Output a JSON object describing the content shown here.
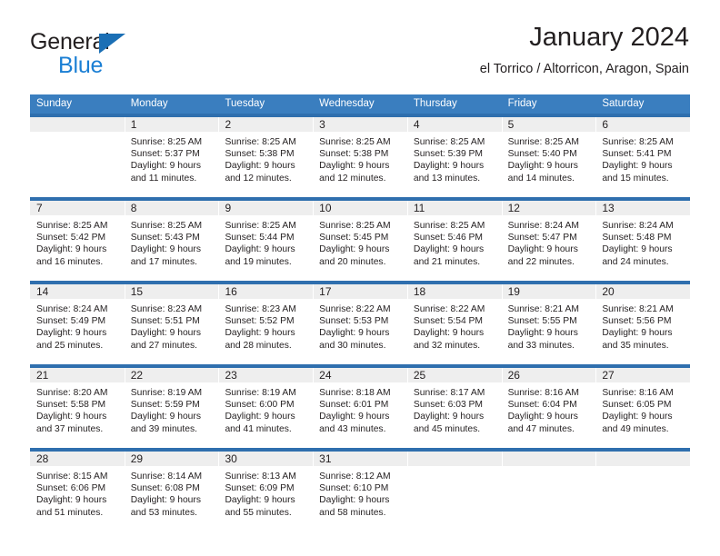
{
  "brand": {
    "name_part1": "General",
    "name_part2": "Blue",
    "triangle_color": "#1b6fb5",
    "blue_text_color": "#1b7fd4"
  },
  "header": {
    "title": "January 2024",
    "subtitle": "el Torrico / Altorricon, Aragon, Spain"
  },
  "theme": {
    "header_row_bg": "#3a7ebf",
    "week_divider": "#2f6fae",
    "daynum_band_bg": "#eeeeee",
    "text_color": "#231f20"
  },
  "weekdays": [
    "Sunday",
    "Monday",
    "Tuesday",
    "Wednesday",
    "Thursday",
    "Friday",
    "Saturday"
  ],
  "weeks": [
    [
      {
        "day": "",
        "sunrise": "",
        "sunset": "",
        "daylight_line1": "",
        "daylight_line2": ""
      },
      {
        "day": "1",
        "sunrise": "Sunrise: 8:25 AM",
        "sunset": "Sunset: 5:37 PM",
        "daylight_line1": "Daylight: 9 hours",
        "daylight_line2": "and 11 minutes."
      },
      {
        "day": "2",
        "sunrise": "Sunrise: 8:25 AM",
        "sunset": "Sunset: 5:38 PM",
        "daylight_line1": "Daylight: 9 hours",
        "daylight_line2": "and 12 minutes."
      },
      {
        "day": "3",
        "sunrise": "Sunrise: 8:25 AM",
        "sunset": "Sunset: 5:38 PM",
        "daylight_line1": "Daylight: 9 hours",
        "daylight_line2": "and 12 minutes."
      },
      {
        "day": "4",
        "sunrise": "Sunrise: 8:25 AM",
        "sunset": "Sunset: 5:39 PM",
        "daylight_line1": "Daylight: 9 hours",
        "daylight_line2": "and 13 minutes."
      },
      {
        "day": "5",
        "sunrise": "Sunrise: 8:25 AM",
        "sunset": "Sunset: 5:40 PM",
        "daylight_line1": "Daylight: 9 hours",
        "daylight_line2": "and 14 minutes."
      },
      {
        "day": "6",
        "sunrise": "Sunrise: 8:25 AM",
        "sunset": "Sunset: 5:41 PM",
        "daylight_line1": "Daylight: 9 hours",
        "daylight_line2": "and 15 minutes."
      }
    ],
    [
      {
        "day": "7",
        "sunrise": "Sunrise: 8:25 AM",
        "sunset": "Sunset: 5:42 PM",
        "daylight_line1": "Daylight: 9 hours",
        "daylight_line2": "and 16 minutes."
      },
      {
        "day": "8",
        "sunrise": "Sunrise: 8:25 AM",
        "sunset": "Sunset: 5:43 PM",
        "daylight_line1": "Daylight: 9 hours",
        "daylight_line2": "and 17 minutes."
      },
      {
        "day": "9",
        "sunrise": "Sunrise: 8:25 AM",
        "sunset": "Sunset: 5:44 PM",
        "daylight_line1": "Daylight: 9 hours",
        "daylight_line2": "and 19 minutes."
      },
      {
        "day": "10",
        "sunrise": "Sunrise: 8:25 AM",
        "sunset": "Sunset: 5:45 PM",
        "daylight_line1": "Daylight: 9 hours",
        "daylight_line2": "and 20 minutes."
      },
      {
        "day": "11",
        "sunrise": "Sunrise: 8:25 AM",
        "sunset": "Sunset: 5:46 PM",
        "daylight_line1": "Daylight: 9 hours",
        "daylight_line2": "and 21 minutes."
      },
      {
        "day": "12",
        "sunrise": "Sunrise: 8:24 AM",
        "sunset": "Sunset: 5:47 PM",
        "daylight_line1": "Daylight: 9 hours",
        "daylight_line2": "and 22 minutes."
      },
      {
        "day": "13",
        "sunrise": "Sunrise: 8:24 AM",
        "sunset": "Sunset: 5:48 PM",
        "daylight_line1": "Daylight: 9 hours",
        "daylight_line2": "and 24 minutes."
      }
    ],
    [
      {
        "day": "14",
        "sunrise": "Sunrise: 8:24 AM",
        "sunset": "Sunset: 5:49 PM",
        "daylight_line1": "Daylight: 9 hours",
        "daylight_line2": "and 25 minutes."
      },
      {
        "day": "15",
        "sunrise": "Sunrise: 8:23 AM",
        "sunset": "Sunset: 5:51 PM",
        "daylight_line1": "Daylight: 9 hours",
        "daylight_line2": "and 27 minutes."
      },
      {
        "day": "16",
        "sunrise": "Sunrise: 8:23 AM",
        "sunset": "Sunset: 5:52 PM",
        "daylight_line1": "Daylight: 9 hours",
        "daylight_line2": "and 28 minutes."
      },
      {
        "day": "17",
        "sunrise": "Sunrise: 8:22 AM",
        "sunset": "Sunset: 5:53 PM",
        "daylight_line1": "Daylight: 9 hours",
        "daylight_line2": "and 30 minutes."
      },
      {
        "day": "18",
        "sunrise": "Sunrise: 8:22 AM",
        "sunset": "Sunset: 5:54 PM",
        "daylight_line1": "Daylight: 9 hours",
        "daylight_line2": "and 32 minutes."
      },
      {
        "day": "19",
        "sunrise": "Sunrise: 8:21 AM",
        "sunset": "Sunset: 5:55 PM",
        "daylight_line1": "Daylight: 9 hours",
        "daylight_line2": "and 33 minutes."
      },
      {
        "day": "20",
        "sunrise": "Sunrise: 8:21 AM",
        "sunset": "Sunset: 5:56 PM",
        "daylight_line1": "Daylight: 9 hours",
        "daylight_line2": "and 35 minutes."
      }
    ],
    [
      {
        "day": "21",
        "sunrise": "Sunrise: 8:20 AM",
        "sunset": "Sunset: 5:58 PM",
        "daylight_line1": "Daylight: 9 hours",
        "daylight_line2": "and 37 minutes."
      },
      {
        "day": "22",
        "sunrise": "Sunrise: 8:19 AM",
        "sunset": "Sunset: 5:59 PM",
        "daylight_line1": "Daylight: 9 hours",
        "daylight_line2": "and 39 minutes."
      },
      {
        "day": "23",
        "sunrise": "Sunrise: 8:19 AM",
        "sunset": "Sunset: 6:00 PM",
        "daylight_line1": "Daylight: 9 hours",
        "daylight_line2": "and 41 minutes."
      },
      {
        "day": "24",
        "sunrise": "Sunrise: 8:18 AM",
        "sunset": "Sunset: 6:01 PM",
        "daylight_line1": "Daylight: 9 hours",
        "daylight_line2": "and 43 minutes."
      },
      {
        "day": "25",
        "sunrise": "Sunrise: 8:17 AM",
        "sunset": "Sunset: 6:03 PM",
        "daylight_line1": "Daylight: 9 hours",
        "daylight_line2": "and 45 minutes."
      },
      {
        "day": "26",
        "sunrise": "Sunrise: 8:16 AM",
        "sunset": "Sunset: 6:04 PM",
        "daylight_line1": "Daylight: 9 hours",
        "daylight_line2": "and 47 minutes."
      },
      {
        "day": "27",
        "sunrise": "Sunrise: 8:16 AM",
        "sunset": "Sunset: 6:05 PM",
        "daylight_line1": "Daylight: 9 hours",
        "daylight_line2": "and 49 minutes."
      }
    ],
    [
      {
        "day": "28",
        "sunrise": "Sunrise: 8:15 AM",
        "sunset": "Sunset: 6:06 PM",
        "daylight_line1": "Daylight: 9 hours",
        "daylight_line2": "and 51 minutes."
      },
      {
        "day": "29",
        "sunrise": "Sunrise: 8:14 AM",
        "sunset": "Sunset: 6:08 PM",
        "daylight_line1": "Daylight: 9 hours",
        "daylight_line2": "and 53 minutes."
      },
      {
        "day": "30",
        "sunrise": "Sunrise: 8:13 AM",
        "sunset": "Sunset: 6:09 PM",
        "daylight_line1": "Daylight: 9 hours",
        "daylight_line2": "and 55 minutes."
      },
      {
        "day": "31",
        "sunrise": "Sunrise: 8:12 AM",
        "sunset": "Sunset: 6:10 PM",
        "daylight_line1": "Daylight: 9 hours",
        "daylight_line2": "and 58 minutes."
      },
      {
        "day": "",
        "sunrise": "",
        "sunset": "",
        "daylight_line1": "",
        "daylight_line2": ""
      },
      {
        "day": "",
        "sunrise": "",
        "sunset": "",
        "daylight_line1": "",
        "daylight_line2": ""
      },
      {
        "day": "",
        "sunrise": "",
        "sunset": "",
        "daylight_line1": "",
        "daylight_line2": ""
      }
    ]
  ]
}
